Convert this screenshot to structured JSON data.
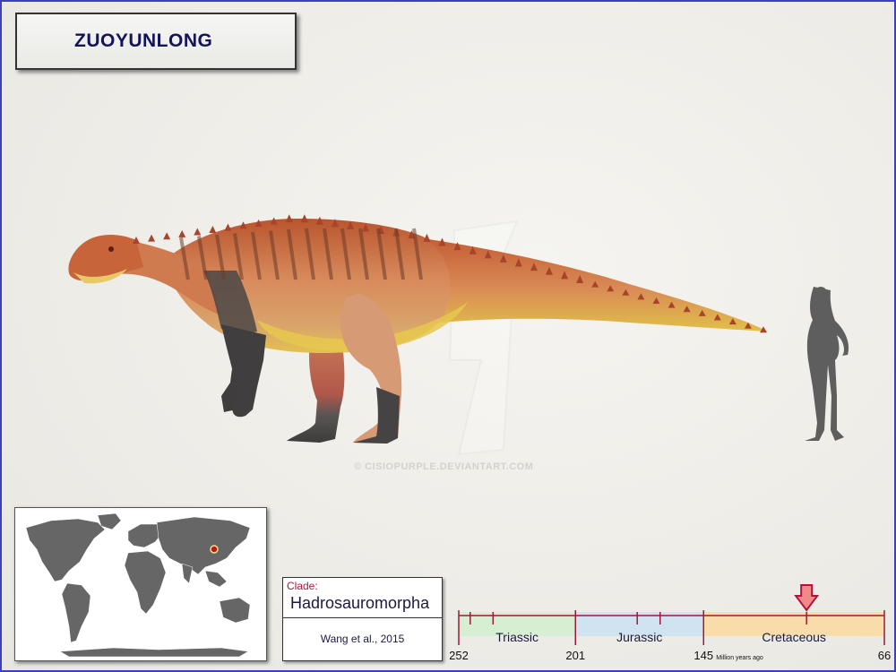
{
  "title": "ZUOYUNLONG",
  "watermark": "© CISIOPURPLE.DEVIANTART.COM",
  "clade": {
    "label": "Clade:",
    "name": "Hadrosauromorpha",
    "citation": "Wang et al., 2015"
  },
  "timeline": {
    "periods": [
      {
        "name": "Triassic",
        "start": 252,
        "end": 201,
        "color": "#d6efd3"
      },
      {
        "name": "Jurassic",
        "start": 201,
        "end": 145,
        "color": "#cfe3f0"
      },
      {
        "name": "Cretaceous",
        "start": 145,
        "end": 66,
        "color": "#f8dcaa"
      }
    ],
    "tick_labels": [
      "252",
      "201",
      "145",
      "66"
    ],
    "unit_label": "Million years ago",
    "marker_age": 100,
    "marker_color": "#f08a8a"
  },
  "map": {
    "location_marker_color": "#c0141e",
    "land_color": "#666666"
  }
}
